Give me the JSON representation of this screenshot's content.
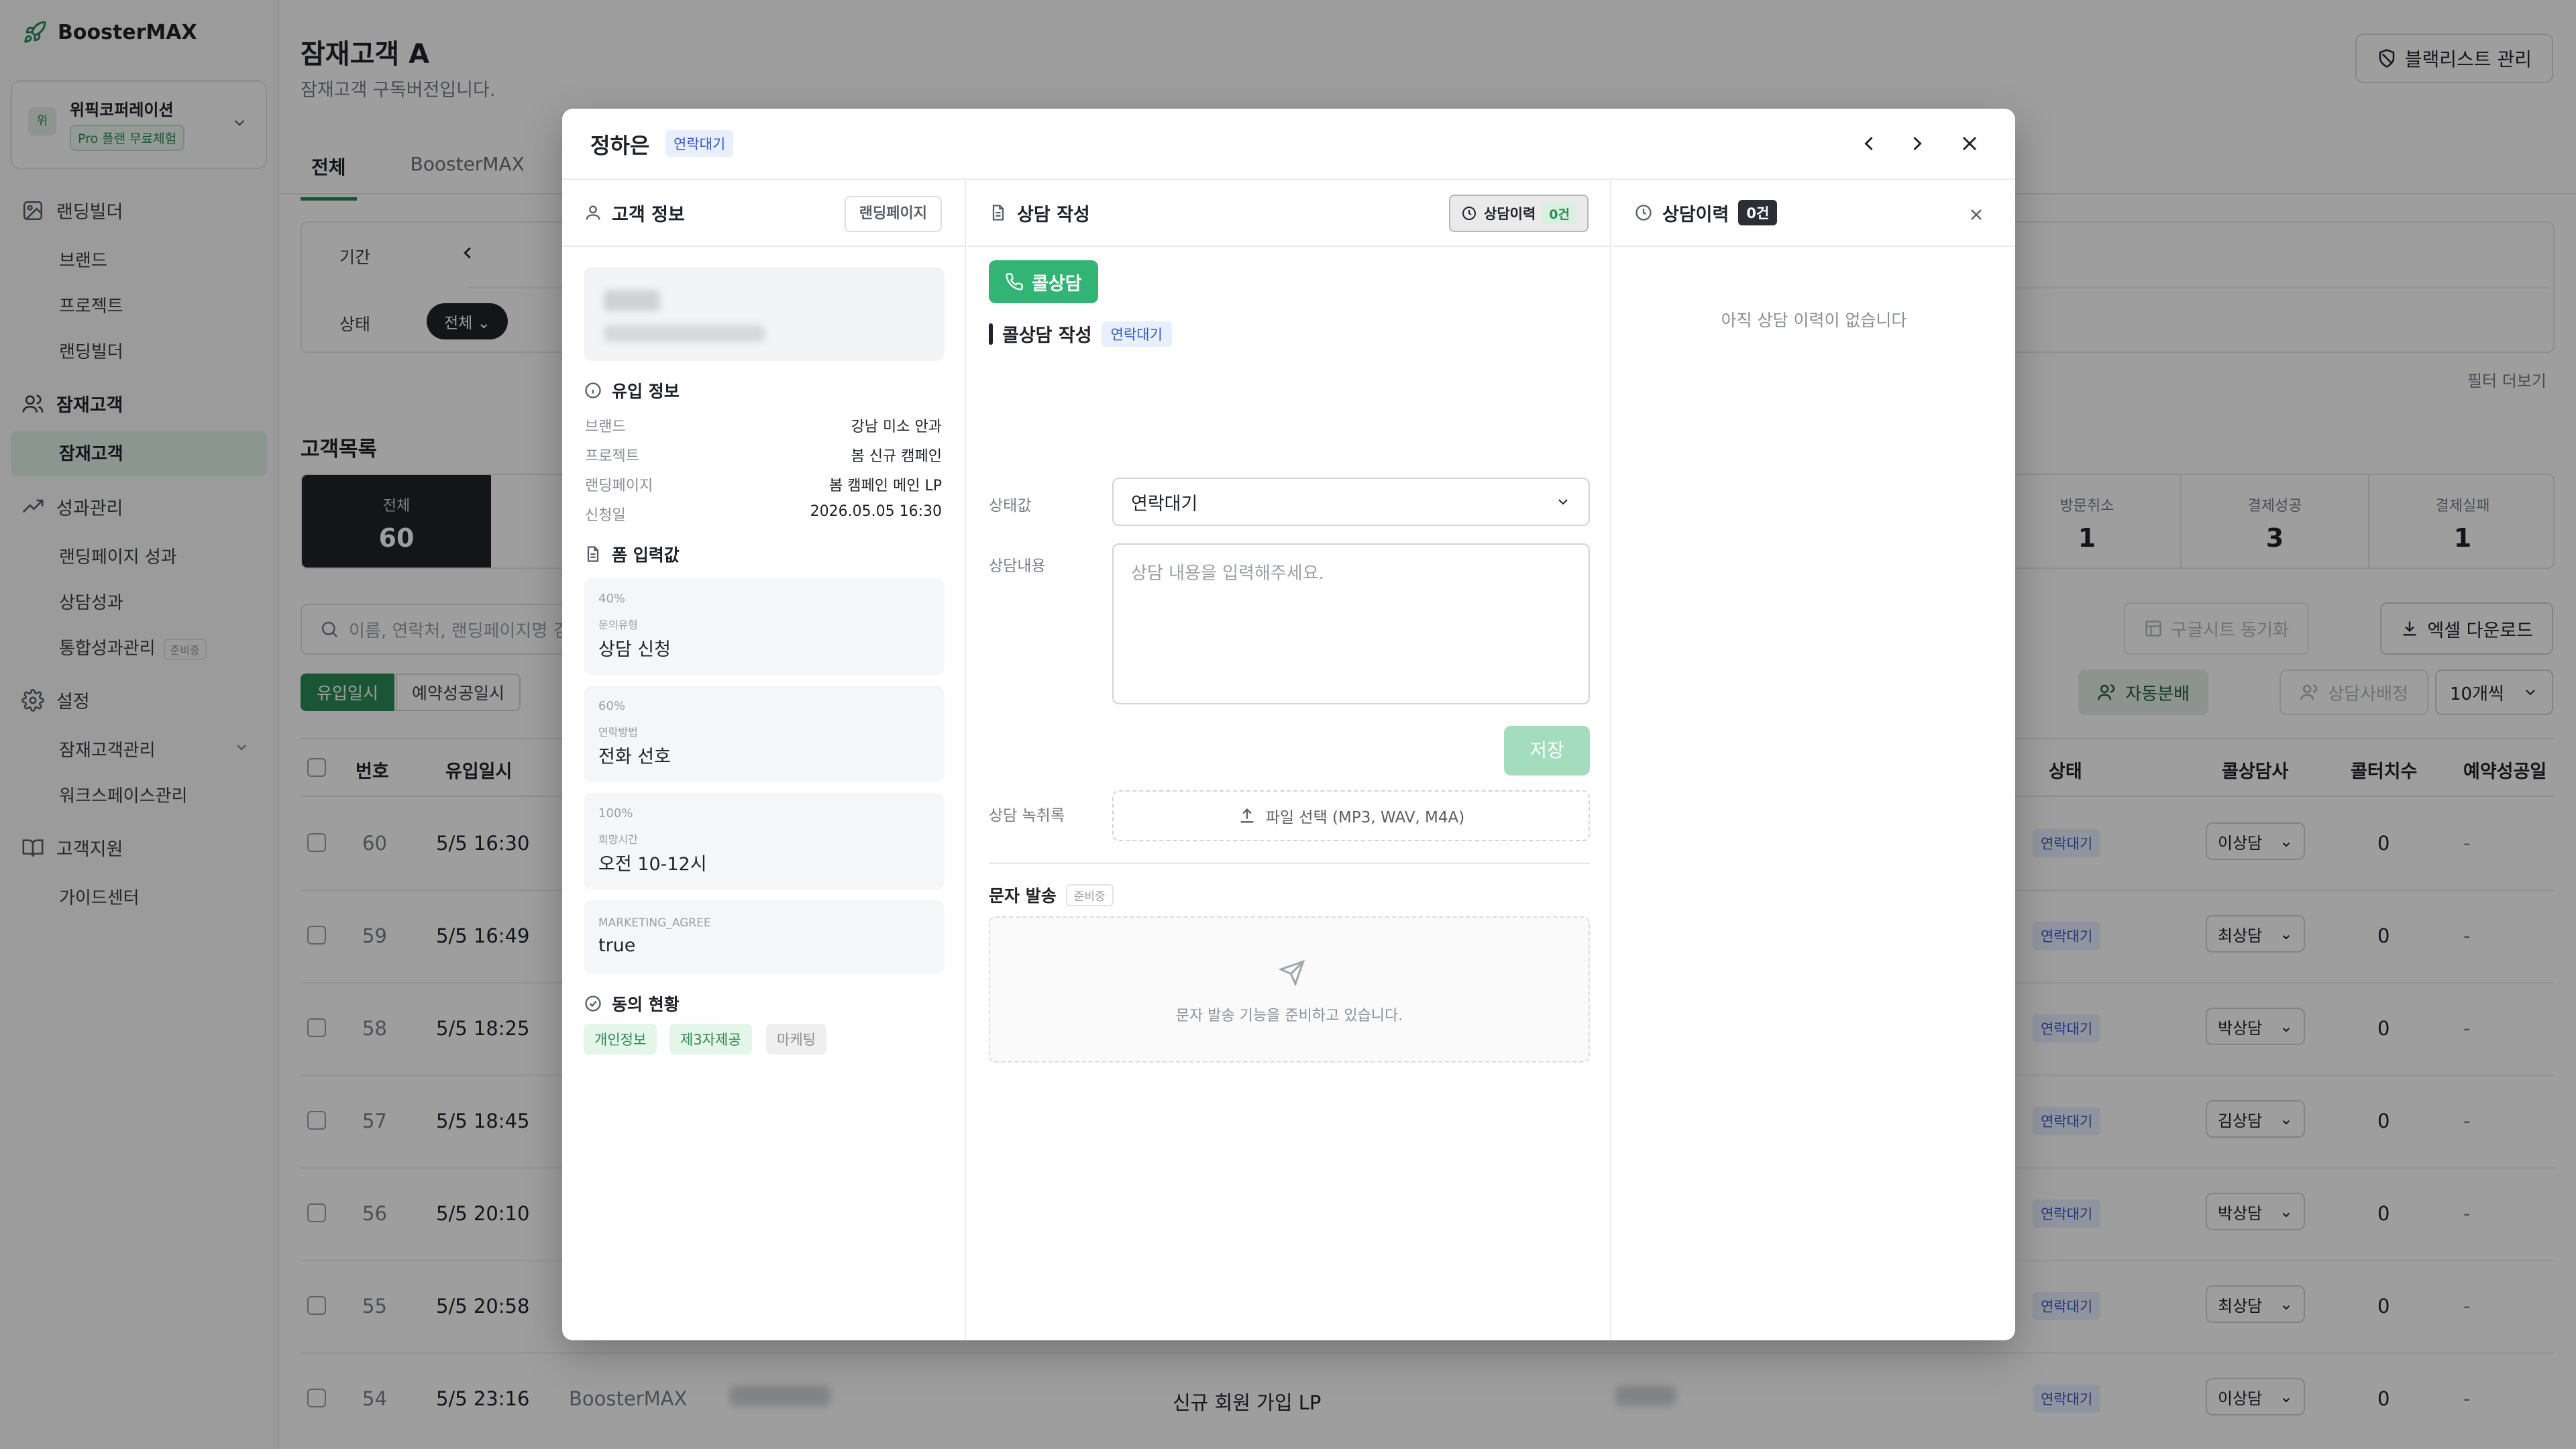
{
  "app": {
    "name": "BoosterMAX"
  },
  "workspace": {
    "avatar": "위",
    "name": "위픽코퍼레이션",
    "plan": "Pro 플랜 무료체험"
  },
  "sidebar": {
    "landing": {
      "label": "랜딩빌더",
      "items": [
        "브랜드",
        "프로젝트",
        "랜딩빌더"
      ]
    },
    "prospect": {
      "label": "잠재고객",
      "items": [
        "잠재고객"
      ]
    },
    "perf": {
      "label": "성과관리",
      "items": [
        "랜딩페이지 성과",
        "상담성과",
        "통합성과관리"
      ],
      "soon": "준비중"
    },
    "settings": {
      "label": "설정",
      "items": [
        "잠재고객관리",
        "워크스페이스관리"
      ]
    },
    "support": {
      "label": "고객지원",
      "items": [
        "가이드센터"
      ]
    }
  },
  "page": {
    "title": "잠재고객 A",
    "subtitle": "잠재고객 구독버전입니다.",
    "blacklist": "블랙리스트 관리",
    "tabs": [
      "전체",
      "BoosterMAX"
    ],
    "filter_period": "기간",
    "filter_status": "상태",
    "status_chip": "전체",
    "filter_more": "필터 더보기",
    "list_title": "고객목록",
    "stats": [
      {
        "label": "전체",
        "value": "60"
      },
      {
        "label": "방문취소",
        "value": "1"
      },
      {
        "label": "결제성공",
        "value": "3"
      },
      {
        "label": "결제실패",
        "value": "1"
      }
    ],
    "search_placeholder": "이름, 연락처, 랜딩페이지명 검",
    "gsheet": "구글시트 동기화",
    "excel": "엑셀 다운로드",
    "sort": [
      "유입일시",
      "예약성공일시"
    ],
    "auto": "자동분배",
    "assign": "상담사배정",
    "per_page": "10개씩",
    "headers": {
      "no": "번호",
      "in": "유입일시",
      "status": "상태",
      "agent": "콜상담사",
      "count": "콜터치수",
      "resv": "예약성공일"
    },
    "rows": [
      {
        "no": "60",
        "time": "5/5 16:30",
        "status": "연락대기",
        "agent": "이상담",
        "count": "0",
        "resv": "-"
      },
      {
        "no": "59",
        "time": "5/5 16:49",
        "status": "연락대기",
        "agent": "최상담",
        "count": "0",
        "resv": "-"
      },
      {
        "no": "58",
        "time": "5/5 18:25",
        "status": "연락대기",
        "agent": "박상담",
        "count": "0",
        "resv": "-"
      },
      {
        "no": "57",
        "time": "5/5 18:45",
        "status": "연락대기",
        "agent": "김상담",
        "count": "0",
        "resv": "-"
      },
      {
        "no": "56",
        "time": "5/5 20:10",
        "status": "연락대기",
        "agent": "박상담",
        "count": "0",
        "resv": "-"
      },
      {
        "no": "55",
        "time": "5/5 20:58",
        "status": "연락대기",
        "agent": "최상담",
        "count": "0",
        "resv": "-"
      },
      {
        "no": "54",
        "time": "5/5 23:16",
        "status": "연락대기",
        "agent": "이상담",
        "count": "0",
        "resv": "-",
        "brand": "BoosterMAX",
        "landing": "신규 회원 가입 LP"
      }
    ]
  },
  "modal": {
    "name": "정하은",
    "status": "연락대기",
    "left": {
      "title": "고객 정보",
      "landing_btn": "랜딩페이지",
      "inflow_title": "유입 정보",
      "inflow": [
        {
          "k": "브랜드",
          "v": "강남 미소 안과"
        },
        {
          "k": "프로젝트",
          "v": "봄 신규 캠페인"
        },
        {
          "k": "랜딩페이지",
          "v": "봄 캠페인 메인 LP"
        },
        {
          "k": "신청일",
          "v": "2026.05.05 16:30"
        }
      ],
      "form_title": "폼 입력값",
      "form": [
        {
          "pct": "40%",
          "key": "문의유형",
          "val": "상담 신청"
        },
        {
          "pct": "60%",
          "key": "연락방법",
          "val": "전화 선호"
        },
        {
          "pct": "100%",
          "key": "희망시간",
          "val": "오전 10-12시"
        },
        {
          "key": "MARKETING_AGREE",
          "val": "true"
        }
      ],
      "consent_title": "동의 현황",
      "consents": [
        "개인정보",
        "제3자제공",
        "마케팅"
      ]
    },
    "mid": {
      "title": "상담 작성",
      "history_btn": "상담이력",
      "history_count": "0건",
      "call_btn": "콜상담",
      "section": "콜상담 작성",
      "section_status": "연락대기",
      "status_label": "상태값",
      "status_value": "연락대기",
      "content_label": "상담내용",
      "content_placeholder": "상담 내용을 입력해주세요.",
      "save": "저장",
      "record_label": "상담 녹취록",
      "upload": "파일 선택 (MP3, WAV, M4A)",
      "sms_title": "문자 발송",
      "sms_soon": "준비중",
      "sms_text": "문자 발송 기능을 준비하고 있습니다."
    },
    "right": {
      "title": "상담이력",
      "count": "0건",
      "empty": "아직 상담 이력이 없습니다"
    }
  },
  "colors": {
    "brand": "#2a8a58",
    "call": "#32b474",
    "status_badge": "#3757c5"
  }
}
